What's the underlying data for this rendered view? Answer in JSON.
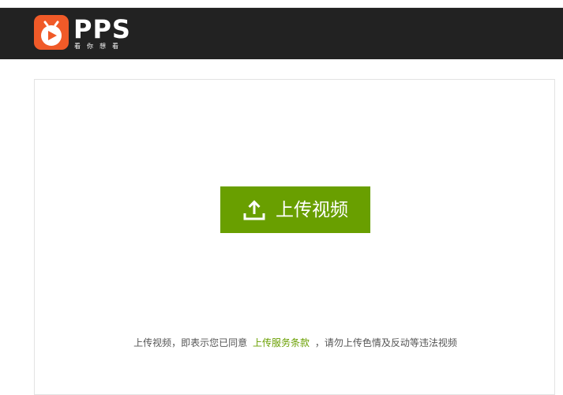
{
  "brand": {
    "name": "PPS",
    "slogan": "看你想看",
    "accent_color": "#f05a28",
    "header_bg": "#222222"
  },
  "upload": {
    "button_label": "上传视频",
    "button_color": "#699f00",
    "icon": "upload-icon"
  },
  "notice": {
    "prefix": "上传视频，即表示您已同意",
    "link": "上传服务条款",
    "suffix": "，请勿上传色情及反动等违法视频"
  }
}
